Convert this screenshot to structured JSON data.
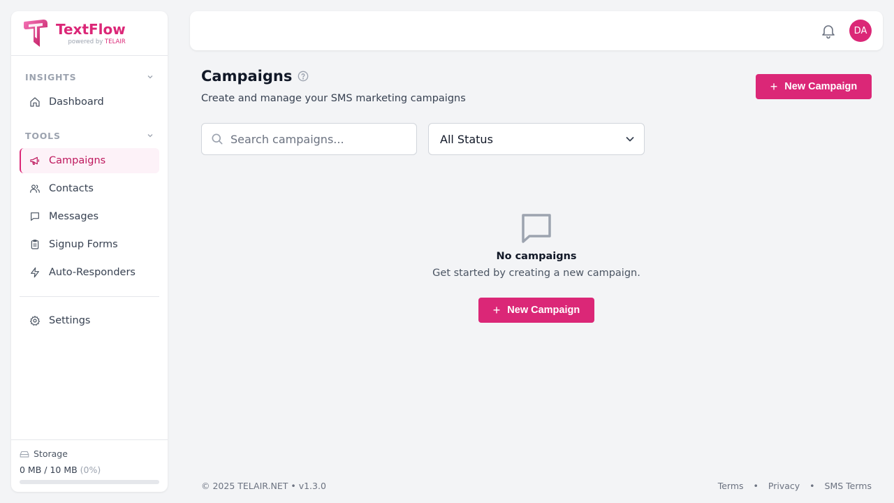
{
  "brand": {
    "name": "TextFlow",
    "powered_by": "powered by",
    "company": "TELAIR"
  },
  "sidebar": {
    "sections": [
      {
        "title": "INSIGHTS"
      },
      {
        "title": "TOOLS"
      }
    ],
    "items": [
      {
        "label": "Dashboard",
        "icon": "home-icon"
      },
      {
        "label": "Campaigns",
        "icon": "megaphone-icon",
        "active": true
      },
      {
        "label": "Contacts",
        "icon": "users-icon"
      },
      {
        "label": "Messages",
        "icon": "message-icon"
      },
      {
        "label": "Signup Forms",
        "icon": "clipboard-icon"
      },
      {
        "label": "Auto-Responders",
        "icon": "bolt-icon"
      },
      {
        "label": "Settings",
        "icon": "gear-icon"
      }
    ],
    "storage": {
      "label": "Storage",
      "value": "0 MB / 10 MB",
      "percent_text": "(0%)",
      "percent": 0
    }
  },
  "header": {
    "avatar_initials": "DA"
  },
  "main": {
    "title": "Campaigns",
    "subtitle": "Create and manage your SMS marketing campaigns",
    "new_campaign_label": "New Campaign",
    "search_placeholder": "Search campaigns...",
    "status_filter": "All Status",
    "empty_title": "No campaigns",
    "empty_subtitle": "Get started by creating a new campaign."
  },
  "footer": {
    "copyright": "© 2025 TELAIR.NET • v1.3.0",
    "links": [
      "Terms",
      "Privacy",
      "SMS Terms"
    ]
  },
  "colors": {
    "accent": "#db2777",
    "background": "#f3f4f6"
  }
}
